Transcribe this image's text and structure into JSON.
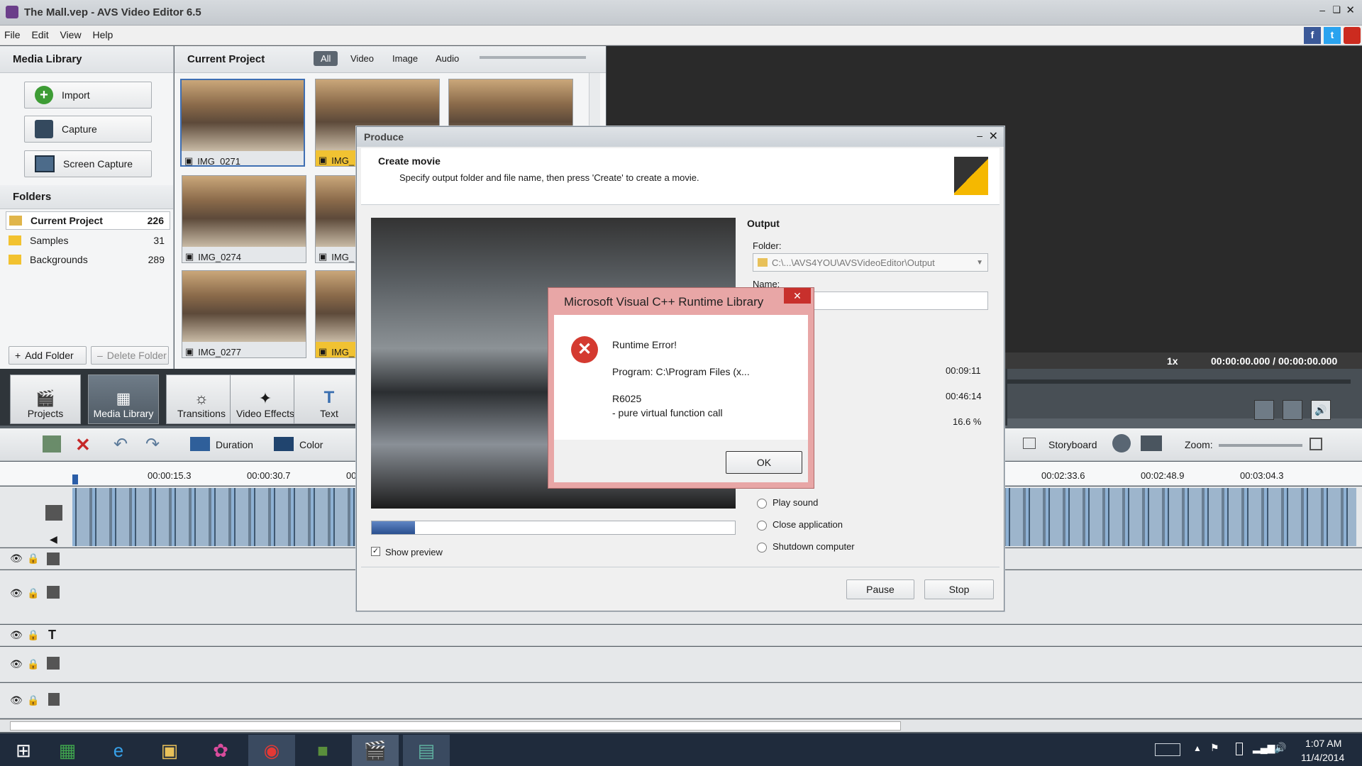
{
  "app": {
    "title": "The Mall.vep - AVS Video Editor 6.5"
  },
  "menu": [
    "File",
    "Edit",
    "View",
    "Help"
  ],
  "media_library": {
    "title": "Media Library",
    "buttons": [
      "Import",
      "Capture",
      "Screen Capture"
    ],
    "folders_title": "Folders",
    "folders": [
      {
        "name": "Current Project",
        "count": "226"
      },
      {
        "name": "Samples",
        "count": "31"
      },
      {
        "name": "Backgrounds",
        "count": "289"
      }
    ],
    "add_folder": "Add Folder",
    "delete_folder": "Delete Folder"
  },
  "current_project": {
    "title": "Current Project",
    "filters": [
      "All",
      "Video",
      "Image",
      "Audio"
    ],
    "thumbs": [
      {
        "label": "IMG_0271"
      },
      {
        "label": "IMG_"
      },
      {
        "label": ""
      },
      {
        "label": "IMG_0274"
      },
      {
        "label": "IMG_"
      },
      {
        "label": "IMG_0277"
      },
      {
        "label": "IMG_"
      }
    ]
  },
  "preview": {
    "speed": "1x",
    "time": "00:00:00.000 / 00:00:00.000"
  },
  "tabs": [
    "Projects",
    "Media Library",
    "Transitions",
    "Video Effects",
    "Text"
  ],
  "timeline_toolbar": {
    "duration": "Duration",
    "color": "Color",
    "storyboard": "Storyboard",
    "zoom": "Zoom:"
  },
  "timeline_ruler": [
    "00:00:15.3",
    "00:00:30.7",
    "00",
    "00:02:33.6",
    "00:02:48.9",
    "00:03:04.3"
  ],
  "produce": {
    "title": "Produce",
    "heading": "Create movie",
    "subtitle": "Specify output folder and file name, then press 'Create' to create a movie.",
    "output_title": "Output",
    "folder_label": "Folder:",
    "folder_value": "C:\\...\\AVS4YOU\\AVSVideoEditor\\Output",
    "name_label": "Name:",
    "stats": [
      "00:09:11",
      "00:46:14",
      "16.6 %"
    ],
    "progress": 0.12,
    "show_preview": "Show preview",
    "options": [
      "Play sound",
      "Close application",
      "Shutdown computer"
    ],
    "pause": "Pause",
    "stop": "Stop"
  },
  "error": {
    "title": "Microsoft Visual C++ Runtime Library",
    "line1": "Runtime Error!",
    "line2": "Program: C:\\Program Files (x...",
    "line3": "R6025",
    "line4": "- pure virtual function call",
    "ok": "OK"
  },
  "tray": {
    "time": "1:07 AM",
    "date": "11/4/2014"
  }
}
